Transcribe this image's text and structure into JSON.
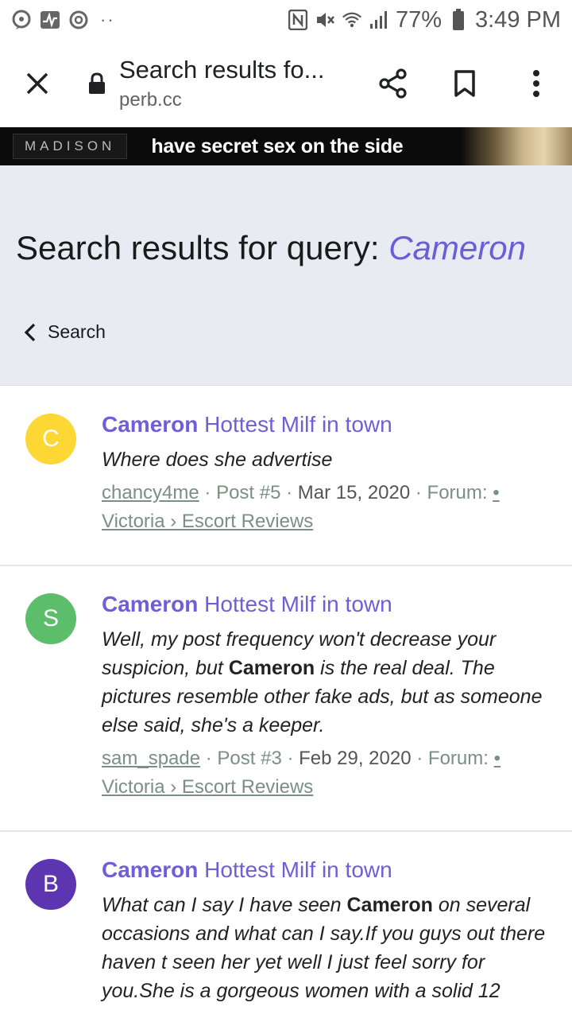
{
  "status_bar": {
    "battery": "77%",
    "time": "3:49 PM"
  },
  "browser": {
    "title": "Search results fo...",
    "url": "perb.cc"
  },
  "ad": {
    "brand": "MADISON",
    "text": "have secret sex on the side"
  },
  "header": {
    "title_prefix": "Search results for query:",
    "query": "Cameron",
    "back_label": "Search"
  },
  "results": [
    {
      "avatar_letter": "C",
      "avatar_color": "#fdd835",
      "title_bold": "Cameron",
      "title_rest": "Hottest Milf in town",
      "snippet_before": "Where does she advertise",
      "snippet_hl": "",
      "snippet_after": "",
      "author": "chancy4me",
      "post": "Post #5",
      "date": "Mar 15, 2020",
      "forum_label": "Forum:",
      "forum_bullet": "•",
      "forum": "Victoria › Escort Reviews"
    },
    {
      "avatar_letter": "S",
      "avatar_color": "#5cbd6a",
      "title_bold": "Cameron",
      "title_rest": "Hottest Milf in town",
      "snippet_before": "Well, my post frequency won't decrease your suspicion, but ",
      "snippet_hl": "Cameron",
      "snippet_after": " is the real deal. The pictures resemble other fake ads, but as someone else said, she's a keeper.",
      "author": "sam_spade",
      "post": "Post #3",
      "date": "Feb 29, 2020",
      "forum_label": "Forum:",
      "forum_bullet": "•",
      "forum": "Victoria › Escort Reviews"
    },
    {
      "avatar_letter": "B",
      "avatar_color": "#5e35b1",
      "title_bold": "Cameron",
      "title_rest": "Hottest Milf in town",
      "snippet_before": "What can I say I have seen ",
      "snippet_hl": "Cameron",
      "snippet_after": " on several occasions and what can I say.If you guys out there haven t seen her yet well I just feel sorry for you.She is a gorgeous women with a solid 12"
    }
  ]
}
